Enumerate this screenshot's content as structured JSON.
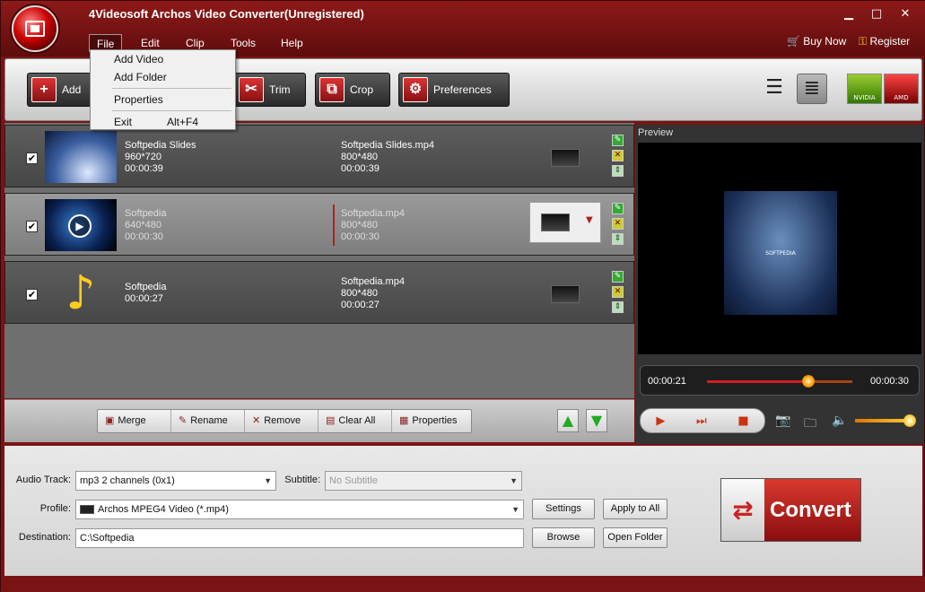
{
  "app": {
    "title": "4Videosoft Archos Video Converter(Unregistered)"
  },
  "menu": {
    "items": [
      "File",
      "Edit",
      "Clip",
      "Tools",
      "Help"
    ],
    "buy_now": "Buy Now",
    "register": "Register"
  },
  "file_menu": {
    "add_video": "Add Video",
    "add_folder": "Add Folder",
    "properties": "Properties",
    "exit": "Exit",
    "exit_shortcut": "Alt+F4"
  },
  "toolbar": {
    "add": "Add",
    "trim": "Trim",
    "crop": "Crop",
    "preferences": "Preferences",
    "gpu_nvidia": "NVIDIA",
    "gpu_amd": "AMD"
  },
  "files": [
    {
      "name": "Softpedia Slides",
      "res": "960*720",
      "dur": "00:00:39",
      "out_name": "Softpedia Slides.mp4",
      "out_res": "800*480",
      "out_dur": "00:00:39",
      "checked": "✔"
    },
    {
      "name": "Softpedia",
      "res": "640*480",
      "dur": "00:00:30",
      "out_name": "Softpedia.mp4",
      "out_res": "800*480",
      "out_dur": "00:00:30",
      "checked": "✔"
    },
    {
      "name": "Softpedia",
      "res": "",
      "dur": "00:00:27",
      "out_name": "Softpedia.mp4",
      "out_res": "800*480",
      "out_dur": "00:00:27",
      "checked": "✔"
    }
  ],
  "list_actions": {
    "merge": "Merge",
    "rename": "Rename",
    "remove": "Remove",
    "clear_all": "Clear All",
    "properties": "Properties"
  },
  "preview": {
    "label": "Preview",
    "image_text": "SOFTPEDIA",
    "current_time": "00:00:21",
    "total_time": "00:00:30",
    "progress": 0.7,
    "volume": 0.95
  },
  "settings": {
    "audio_track_label": "Audio Track:",
    "audio_track": "mp3 2 channels (0x1)",
    "subtitle_label": "Subtitle:",
    "subtitle": "No Subtitle",
    "profile_label": "Profile:",
    "profile": "Archos MPEG4 Video (*.mp4)",
    "destination_label": "Destination:",
    "destination": "C:\\Softpedia",
    "settings_btn": "Settings",
    "apply_all_btn": "Apply to All",
    "browse_btn": "Browse",
    "open_folder_btn": "Open Folder",
    "convert": "Convert"
  },
  "colors": {
    "accent": "#7a1414",
    "convert": "#c8231f"
  }
}
